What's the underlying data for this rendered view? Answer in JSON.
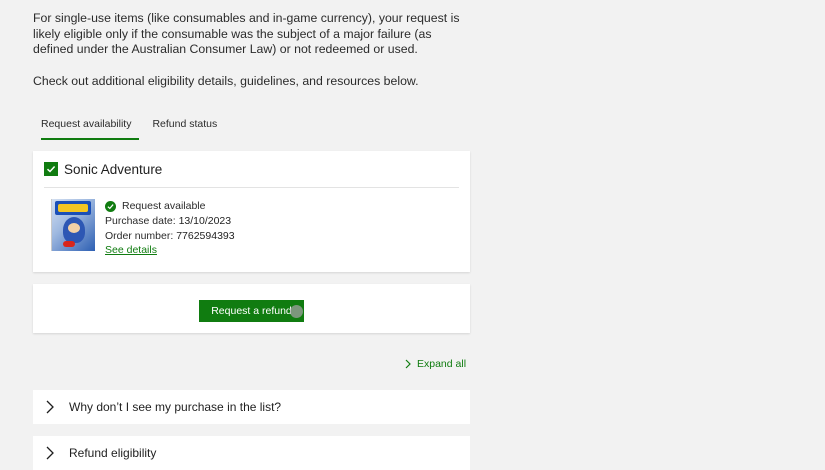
{
  "intro": {
    "paragraph1": "For single-use items (like consumables and in-game currency), your request is likely eligible only if the consumable was the subject of a major failure (as defined under the Australian Consumer Law) or not redeemed or used.",
    "paragraph2": "Check out additional eligibility details, guidelines, and resources below."
  },
  "tabs": [
    {
      "label": "Request availability",
      "active": true
    },
    {
      "label": "Refund status",
      "active": false
    }
  ],
  "game": {
    "title": "Sonic Adventure",
    "checked": true,
    "status": "Request available",
    "purchase_date_label": "Purchase date:",
    "purchase_date": "13/10/2023",
    "order_number_label": "Order number:",
    "order_number": "7762594393",
    "see_details": "See details",
    "cover_icon": "sonic-adventure-box-art"
  },
  "action": {
    "refund_button": "Request a refund"
  },
  "expand_all": "Expand all",
  "accordion": [
    {
      "label": "Why don’t I see my purchase in the list?"
    },
    {
      "label": "Refund eligibility"
    }
  ],
  "colors": {
    "accent": "#107c10",
    "background": "#f2f2f2",
    "card": "#ffffff"
  }
}
